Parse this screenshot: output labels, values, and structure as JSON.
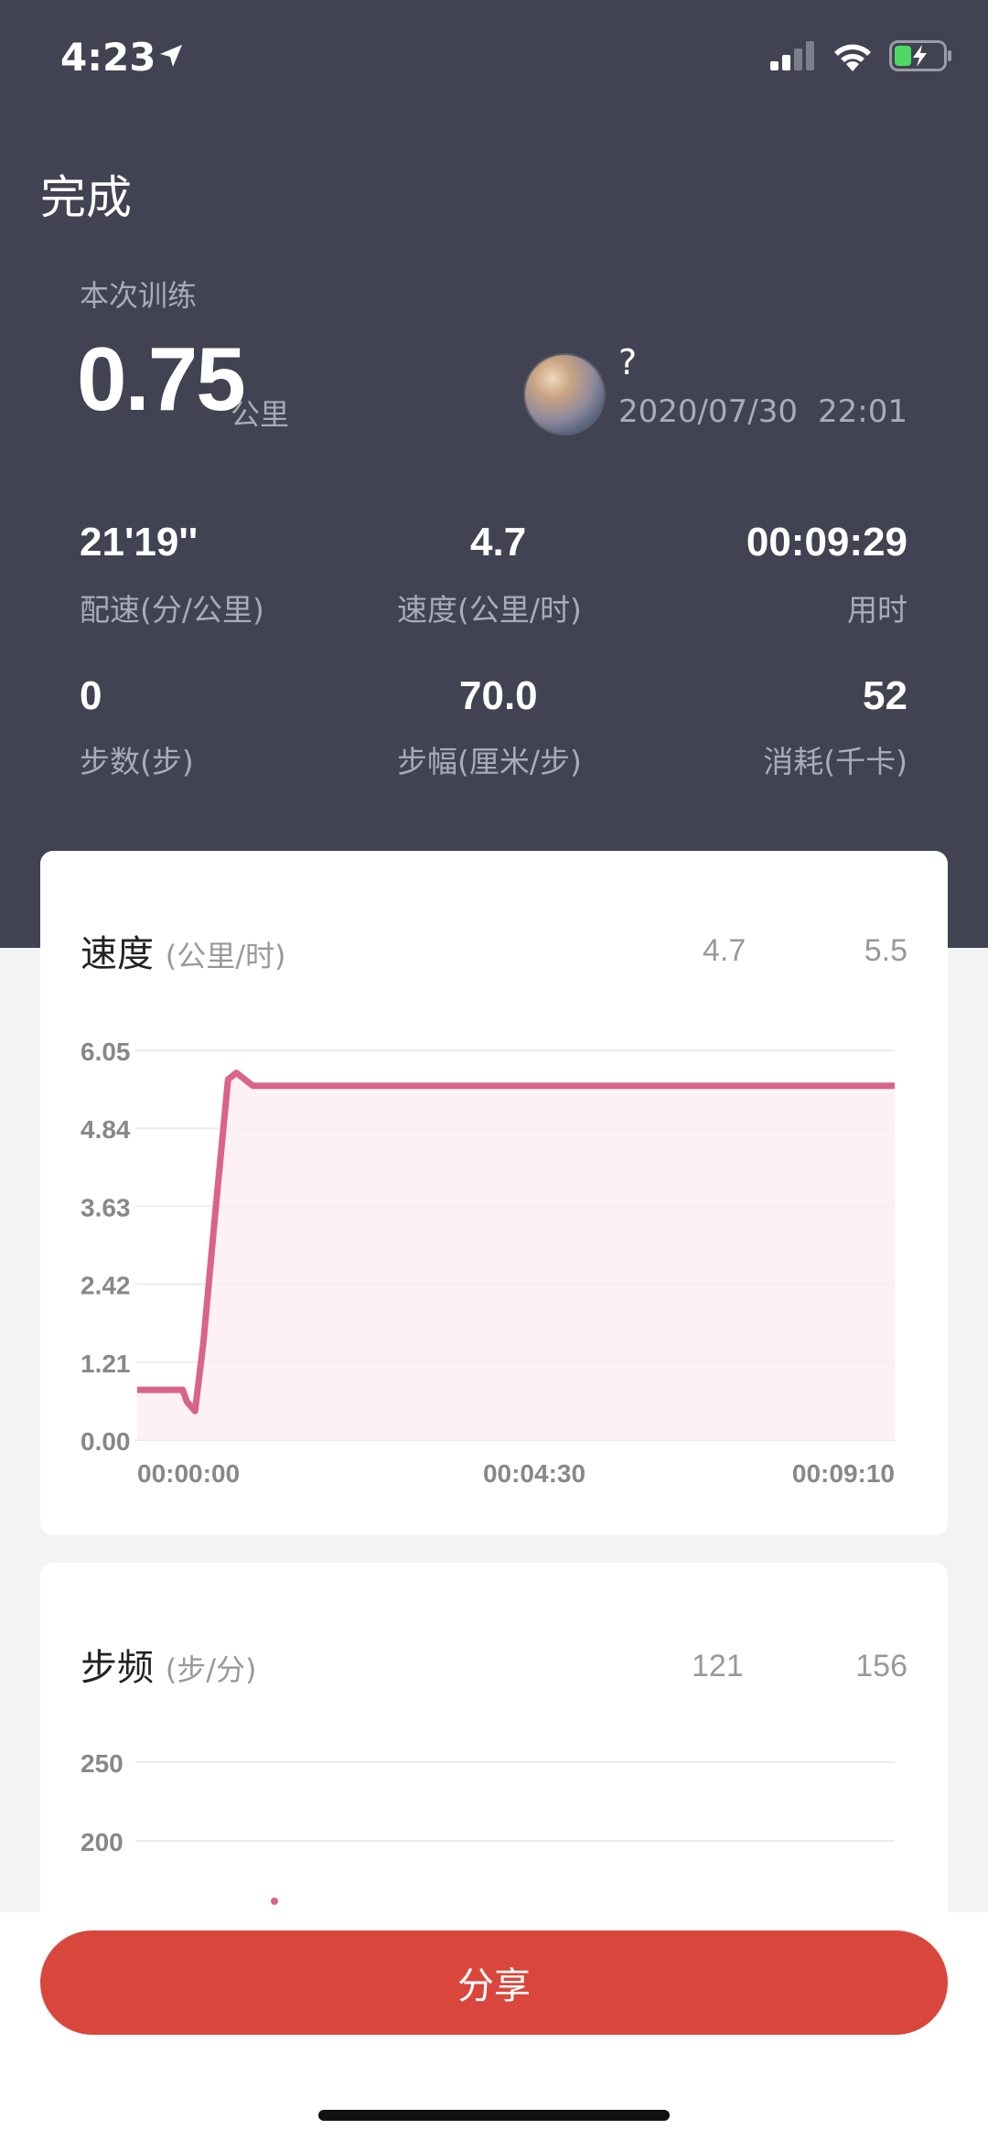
{
  "status_bar": {
    "time": "4:23"
  },
  "header": {
    "title": "完成"
  },
  "session": {
    "label": "本次训练",
    "distance": "0.75",
    "distance_unit": "公里",
    "user_name": "?",
    "date": "2020/07/30",
    "time": "22:01"
  },
  "stats": [
    {
      "value": "21'19''",
      "label": "配速(分/公里)"
    },
    {
      "value": "4.7",
      "label": "速度(公里/时)"
    },
    {
      "value": "00:09:29",
      "label": "用时"
    },
    {
      "value": "0",
      "label": "步数(步)"
    },
    {
      "value": "70.0",
      "label": "步幅(厘米/步)"
    },
    {
      "value": "52",
      "label": "消耗(千卡)"
    }
  ],
  "speed_card": {
    "title": "速度",
    "unit": "(公里/时)",
    "avg": "4.7",
    "max": "5.5"
  },
  "cadence_card": {
    "title": "步频",
    "unit": "(步/分)",
    "avg": "121",
    "max": "156"
  },
  "share_button": "分享",
  "colors": {
    "header_bg": "#414352",
    "accent_line": "#d9638a",
    "share": "#d9473c"
  },
  "chart_data": [
    {
      "type": "line",
      "title": "速度 (公里/时)",
      "x_ticks": [
        "00:00:00",
        "00:04:30",
        "00:09:10"
      ],
      "y_ticks": [
        "6.05",
        "4.84",
        "3.63",
        "2.42",
        "1.21",
        "0.00"
      ],
      "ylim": [
        0,
        6.05
      ],
      "x": [
        0,
        0.3,
        0.55,
        0.6,
        0.7,
        0.8,
        0.95,
        1.1,
        1.2,
        1.4,
        2,
        4,
        6,
        8,
        9.17
      ],
      "series": [
        {
          "values": [
            0.78,
            0.78,
            0.78,
            0.6,
            0.45,
            1.5,
            3.6,
            5.6,
            5.7,
            5.5,
            5.5,
            5.5,
            5.5,
            5.5,
            5.5
          ]
        }
      ],
      "grid": true
    },
    {
      "type": "line",
      "title": "步频 (步/分)",
      "y_ticks": [
        "250",
        "200"
      ],
      "grid": true
    }
  ]
}
